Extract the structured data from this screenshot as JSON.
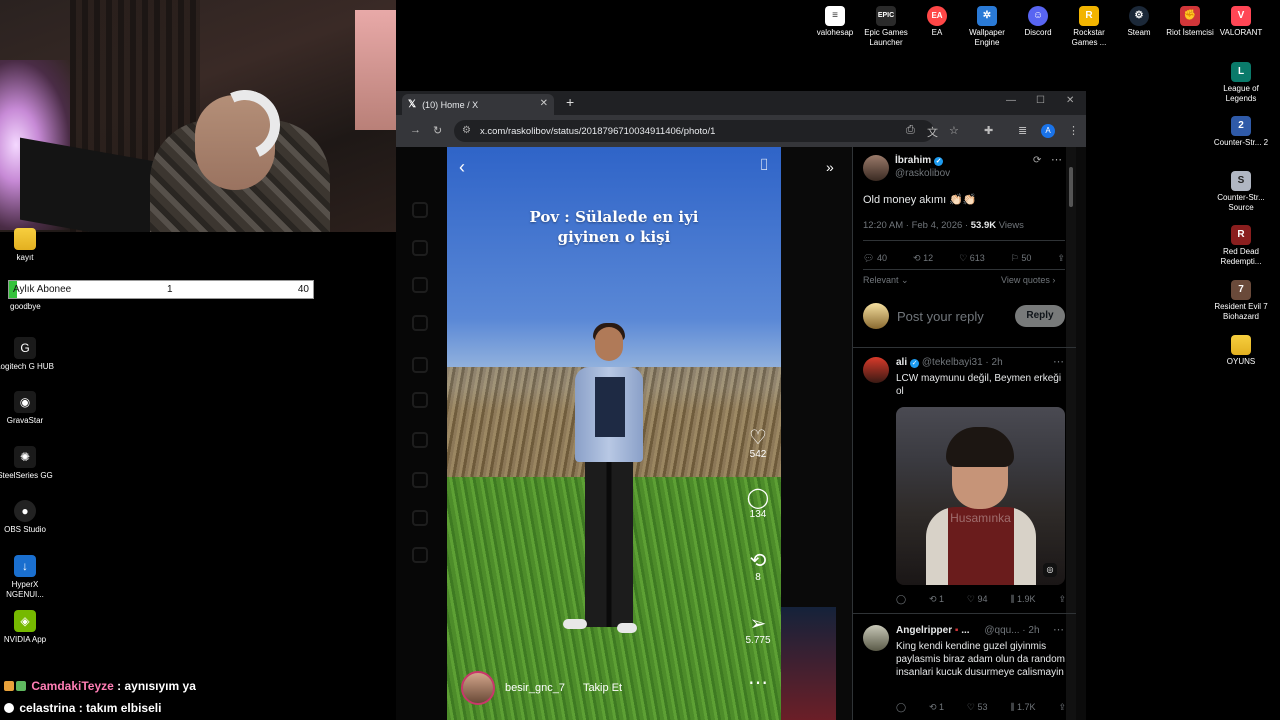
{
  "desktop": {
    "top_icons": [
      {
        "label": "valohesap",
        "icon": "document-icon",
        "color": "#ffffff"
      },
      {
        "label": "Epic Games Launcher",
        "icon": "epic-games-icon",
        "color": "#2a2a2a"
      },
      {
        "label": "EA",
        "icon": "ea-icon",
        "color": "#ff4747"
      },
      {
        "label": "Wallpaper Engine",
        "icon": "wallpaper-engine-icon",
        "color": "#2a7ad6"
      },
      {
        "label": "Discord",
        "icon": "discord-icon",
        "color": "#5865f2"
      },
      {
        "label": "Rockstar Games ...",
        "icon": "rockstar-icon",
        "color": "#f2b400"
      },
      {
        "label": "Steam",
        "icon": "steam-icon",
        "color": "#1b2838"
      },
      {
        "label": "Riot İstemcisi",
        "icon": "riot-icon",
        "color": "#d13639"
      },
      {
        "label": "VALORANT",
        "icon": "valorant-icon",
        "color": "#ff4655"
      }
    ],
    "right_icons": [
      {
        "label": "League of Legends",
        "icon": "league-of-legends-icon",
        "color": "#0a7a6a"
      },
      {
        "label": "Counter-Str... 2",
        "icon": "counter-strike-2-icon",
        "color": "#2f5aa8"
      },
      {
        "label": "Counter-Str... Source",
        "icon": "counter-strike-source-icon",
        "color": "#b0b6c2"
      },
      {
        "label": "Red Dead Redempti...",
        "icon": "red-dead-icon",
        "color": "#8a1e1e"
      },
      {
        "label": "Resident Evil 7 Biohazard",
        "icon": "resident-evil-icon",
        "color": "#6a4a3a"
      },
      {
        "label": "OYUNS",
        "icon": "folder-icon",
        "color": "#f2c12e"
      }
    ],
    "left_icons": [
      {
        "label": "kayıt",
        "icon": "folder-icon"
      },
      {
        "label": "Logitech G HUB",
        "icon": "logitech-icon"
      },
      {
        "label": "GravaStar",
        "icon": "gravastar-icon"
      },
      {
        "label": "SteelSeries GG",
        "icon": "steelseries-icon"
      },
      {
        "label": "OBS Studio",
        "icon": "obs-icon"
      },
      {
        "label": "HyperX NGENUI...",
        "icon": "hyperx-icon"
      },
      {
        "label": "NVIDIA App",
        "icon": "nvidia-icon"
      }
    ]
  },
  "goal": {
    "label": "Aylık Abonee",
    "current": "1",
    "max": "40",
    "fill_fraction": 0.025,
    "under_label": "goodbye"
  },
  "chat": [
    {
      "user": "CamdakiTeyze",
      "message": " : aynısıyım ya"
    },
    {
      "user": "celastrina",
      "message": " : takım elbiseli"
    }
  ],
  "browser": {
    "tab_title": "(10) Home / X",
    "url": "x.com/raskolibov/status/2018796710034911406/photo/1",
    "avatar_letter": "A"
  },
  "video": {
    "caption_line1": "Pov : Sülalede en iyi",
    "caption_line2": "giyinen o kişi",
    "likes": "542",
    "comments": "134",
    "reposts": "8",
    "shares": "5.775",
    "author": "besir_gnc_7",
    "follow_label": "Takip Et"
  },
  "tweet": {
    "name": "İbrahim",
    "handle": "@raskolibov",
    "text": "Old money akımı 👏🏻👏🏻",
    "timestamp": "12:20 AM · Feb 4, 2026 · ",
    "views_count": "53.9K",
    "views_label": " Views",
    "replies": "40",
    "retweets": "12",
    "likes": "613",
    "bookmarks": "50",
    "sort_label": "Relevant ⌄",
    "view_quotes": "View quotes ›",
    "reply_placeholder": "Post your reply",
    "reply_button": "Reply"
  },
  "replies": [
    {
      "name": "ali",
      "handle": "@tekelbayi31 · 2h",
      "text": "LCW maymunu  değil, Beymen erkeği ol",
      "image_watermark": "Husamınka",
      "replies": "",
      "retweets": "1",
      "likes": "94",
      "views": "1.9K"
    },
    {
      "name": "Angelripper",
      "name_suffix": " ...",
      "handle": "@qqu... · 2h",
      "text": "King kendi kendine guzel giyinmis paylasmis biraz adam olun da random insanlari kucuk dusurmeye calismayin",
      "replies": "",
      "retweets": "1",
      "likes": "53",
      "views": "1.7K"
    }
  ]
}
